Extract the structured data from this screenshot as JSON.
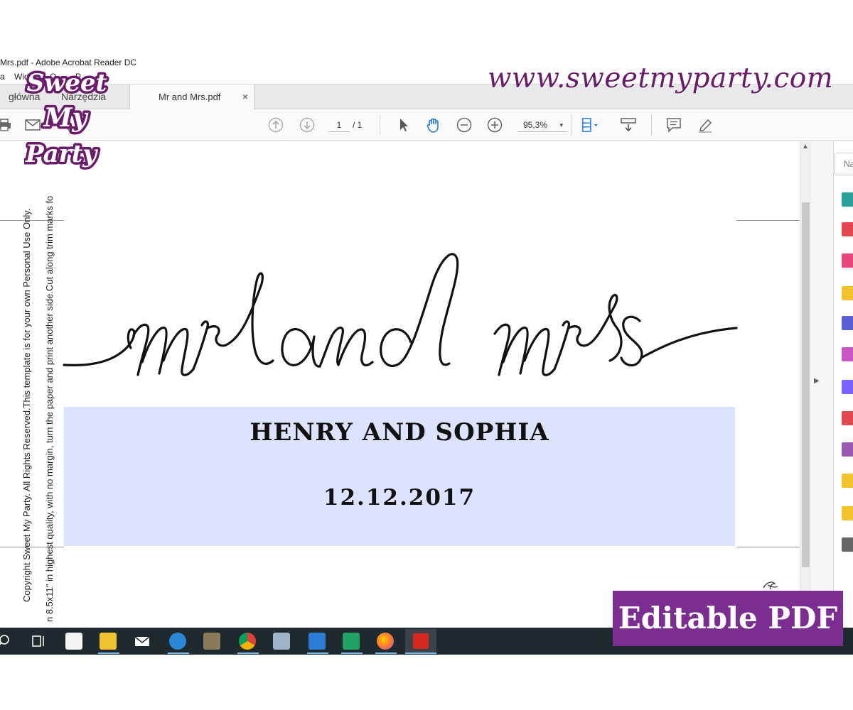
{
  "window": {
    "title": "Mrs.pdf - Adobe Acrobat Reader DC"
  },
  "menu": {
    "items": [
      "a",
      "Wido",
      "O",
      "P"
    ]
  },
  "tabs": {
    "home": "główna",
    "tools": "Narzędzia",
    "document": "Mr and Mrs.pdf",
    "close": "×"
  },
  "toolbar": {
    "page_current": "1",
    "page_total": "/ 1",
    "zoom": "95,3%",
    "zoom_arrow": "▾"
  },
  "right_pane": {
    "search_placeholder": "Na"
  },
  "document": {
    "script_title": "mr and mrs",
    "couple_names": "HENRY AND SOPHIA",
    "date": "12.12.2017",
    "copyright_line": "Copyright Sweet My Party. All Rights Reserved.This template is for your own Personal Use Only.",
    "print_line": "n 8.5x11\" in highest quality, with no margin, turn the paper and print another side.Cut along trim marks fo"
  },
  "overlays": {
    "website": "www.sweetmyparty.com",
    "logo_lines": [
      "Sweet",
      "My",
      "Party"
    ],
    "badge": "Editable PDF"
  },
  "colors": {
    "brand_purple": "#7b2d91",
    "url_purple": "#6a1b6b",
    "banner_blue": "#dce3fe",
    "taskbar": "#1f2a2e",
    "acrobat_red": "#d7261e"
  },
  "icons": {
    "toolbar": [
      "print-icon",
      "email-icon",
      "search-icon",
      "page-up-icon",
      "page-down-icon",
      "select-arrow-icon",
      "hand-icon",
      "zoom-out-icon",
      "zoom-in-icon",
      "fit-page-icon",
      "scroll-mode-icon",
      "comment-icon",
      "highlight-icon"
    ],
    "taskbar": [
      "search-icon",
      "task-view-icon",
      "store-icon",
      "file-explorer-icon",
      "mail-icon",
      "chat-icon",
      "photos-icon",
      "chrome-icon",
      "app-icon",
      "word-icon",
      "sheets-icon",
      "firefox-icon",
      "acrobat-icon"
    ]
  }
}
